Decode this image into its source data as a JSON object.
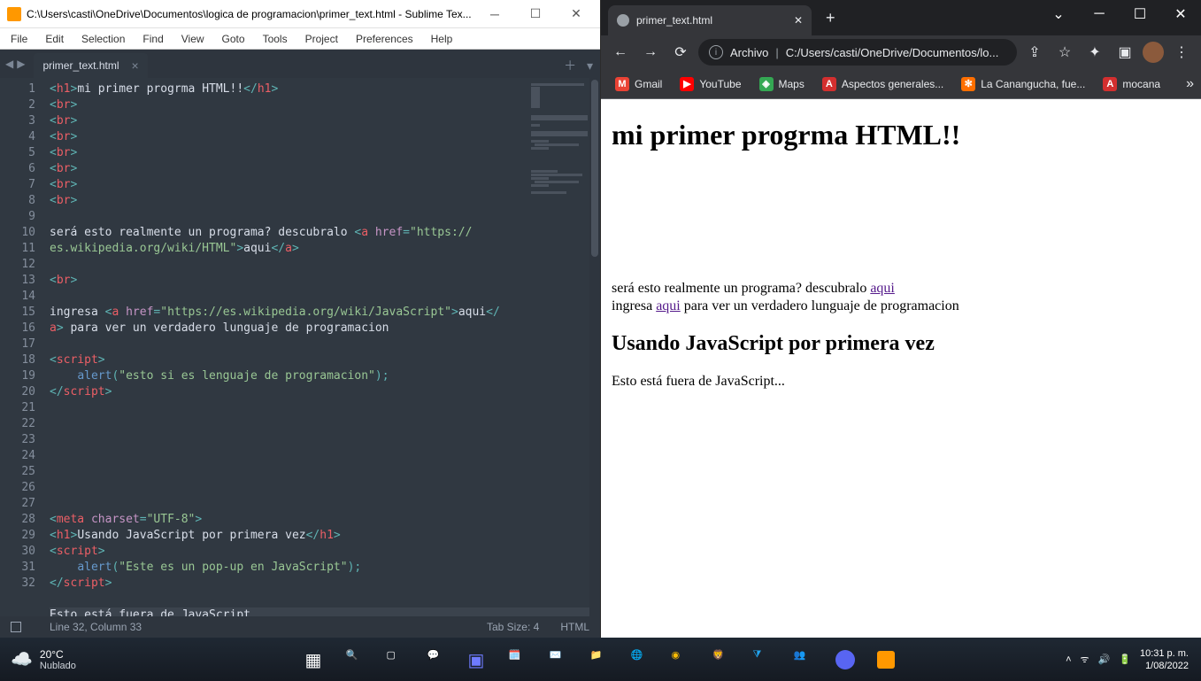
{
  "sublime": {
    "title": "C:\\Users\\casti\\OneDrive\\Documentos\\logica de programacion\\primer_text.html - Sublime Tex...",
    "menu": [
      "File",
      "Edit",
      "Selection",
      "Find",
      "View",
      "Goto",
      "Tools",
      "Project",
      "Preferences",
      "Help"
    ],
    "tab_name": "primer_text.html",
    "status_lines": "Line 32, Column 33",
    "status_tab": "Tab Size: 4",
    "status_lang": "HTML",
    "code": [
      {
        "n": 1,
        "seg": [
          [
            "punct",
            "<"
          ],
          [
            "tag",
            "h1"
          ],
          [
            "punct",
            ">"
          ],
          [
            "txt",
            "mi primer progrma HTML!!"
          ],
          [
            "punct",
            "</"
          ],
          [
            "tag",
            "h1"
          ],
          [
            "punct",
            ">"
          ]
        ]
      },
      {
        "n": 2,
        "seg": [
          [
            "punct",
            "<"
          ],
          [
            "tag",
            "br"
          ],
          [
            "punct",
            ">"
          ]
        ]
      },
      {
        "n": 3,
        "seg": [
          [
            "punct",
            "<"
          ],
          [
            "tag",
            "br"
          ],
          [
            "punct",
            ">"
          ]
        ]
      },
      {
        "n": 4,
        "seg": [
          [
            "punct",
            "<"
          ],
          [
            "tag",
            "br"
          ],
          [
            "punct",
            ">"
          ]
        ]
      },
      {
        "n": 5,
        "seg": [
          [
            "punct",
            "<"
          ],
          [
            "tag",
            "br"
          ],
          [
            "punct",
            ">"
          ]
        ]
      },
      {
        "n": 6,
        "seg": [
          [
            "punct",
            "<"
          ],
          [
            "tag",
            "br"
          ],
          [
            "punct",
            ">"
          ]
        ]
      },
      {
        "n": 7,
        "seg": [
          [
            "punct",
            "<"
          ],
          [
            "tag",
            "br"
          ],
          [
            "punct",
            ">"
          ]
        ]
      },
      {
        "n": 8,
        "seg": [
          [
            "punct",
            "<"
          ],
          [
            "tag",
            "br"
          ],
          [
            "punct",
            ">"
          ]
        ]
      },
      {
        "n": 9,
        "seg": []
      },
      {
        "n": 10,
        "seg": [
          [
            "txt",
            "será esto realmente un programa? descubralo "
          ],
          [
            "punct",
            "<"
          ],
          [
            "tag",
            "a"
          ],
          [
            "txt",
            " "
          ],
          [
            "attr",
            "href"
          ],
          [
            "punct",
            "="
          ],
          [
            "str",
            "\"https://"
          ]
        ]
      },
      {
        "n": "",
        "seg": [
          [
            "str",
            "es.wikipedia.org/wiki/HTML\""
          ],
          [
            "punct",
            ">"
          ],
          [
            "txt",
            "aqui"
          ],
          [
            "punct",
            "</"
          ],
          [
            "tag",
            "a"
          ],
          [
            "punct",
            ">"
          ]
        ]
      },
      {
        "n": 11,
        "seg": []
      },
      {
        "n": 12,
        "seg": [
          [
            "punct",
            "<"
          ],
          [
            "tag",
            "br"
          ],
          [
            "punct",
            ">"
          ]
        ]
      },
      {
        "n": 13,
        "seg": []
      },
      {
        "n": 14,
        "seg": [
          [
            "txt",
            "ingresa "
          ],
          [
            "punct",
            "<"
          ],
          [
            "tag",
            "a"
          ],
          [
            "txt",
            " "
          ],
          [
            "attr",
            "href"
          ],
          [
            "punct",
            "="
          ],
          [
            "str",
            "\"https://es.wikipedia.org/wiki/JavaScript\""
          ],
          [
            "punct",
            ">"
          ],
          [
            "txt",
            "aqui"
          ],
          [
            "punct",
            "</"
          ]
        ]
      },
      {
        "n": "",
        "seg": [
          [
            "tag",
            "a"
          ],
          [
            "punct",
            ">"
          ],
          [
            "txt",
            " para ver un verdadero lunguaje de programacion"
          ]
        ]
      },
      {
        "n": 15,
        "seg": []
      },
      {
        "n": 16,
        "seg": [
          [
            "punct",
            "<"
          ],
          [
            "tag",
            "script"
          ],
          [
            "punct",
            ">"
          ]
        ]
      },
      {
        "n": 17,
        "seg": [
          [
            "txt",
            "    "
          ],
          [
            "fn",
            "alert"
          ],
          [
            "punct",
            "("
          ],
          [
            "str",
            "\"esto si es lenguaje de programacion\""
          ],
          [
            "punct",
            ");"
          ]
        ]
      },
      {
        "n": 18,
        "seg": [
          [
            "punct",
            "</"
          ],
          [
            "tag",
            "script"
          ],
          [
            "punct",
            ">"
          ]
        ]
      },
      {
        "n": 19,
        "seg": []
      },
      {
        "n": 20,
        "seg": []
      },
      {
        "n": 21,
        "seg": []
      },
      {
        "n": 22,
        "seg": []
      },
      {
        "n": 23,
        "seg": []
      },
      {
        "n": 24,
        "seg": []
      },
      {
        "n": 25,
        "seg": []
      },
      {
        "n": 26,
        "seg": [
          [
            "punct",
            "<"
          ],
          [
            "tag",
            "meta"
          ],
          [
            "txt",
            " "
          ],
          [
            "attr",
            "charset"
          ],
          [
            "punct",
            "="
          ],
          [
            "str",
            "\"UTF-8\""
          ],
          [
            "punct",
            ">"
          ]
        ]
      },
      {
        "n": 27,
        "seg": [
          [
            "punct",
            "<"
          ],
          [
            "tag",
            "h1"
          ],
          [
            "punct",
            ">"
          ],
          [
            "txt",
            "Usando JavaScript por primera vez"
          ],
          [
            "punct",
            "</"
          ],
          [
            "tag",
            "h1"
          ],
          [
            "punct",
            ">"
          ]
        ]
      },
      {
        "n": 28,
        "seg": [
          [
            "punct",
            "<"
          ],
          [
            "tag",
            "script"
          ],
          [
            "punct",
            ">"
          ]
        ]
      },
      {
        "n": 29,
        "seg": [
          [
            "txt",
            "    "
          ],
          [
            "fn",
            "alert"
          ],
          [
            "punct",
            "("
          ],
          [
            "str",
            "\"Este es un pop-up en JavaScript\""
          ],
          [
            "punct",
            ");"
          ]
        ]
      },
      {
        "n": 30,
        "seg": [
          [
            "punct",
            "</"
          ],
          [
            "tag",
            "script"
          ],
          [
            "punct",
            ">"
          ]
        ]
      },
      {
        "n": 31,
        "seg": []
      },
      {
        "n": 32,
        "hl": true,
        "seg": [
          [
            "txt",
            "Esto está fuera de JavaScript..."
          ]
        ]
      }
    ]
  },
  "chrome": {
    "tab_title": "primer_text.html",
    "omni_label": "Archivo",
    "omni_path": "C:/Users/casti/OneDrive/Documentos/lo...",
    "bookmarks": [
      {
        "ico": "M",
        "bg": "#ea4335",
        "label": "Gmail"
      },
      {
        "ico": "▶",
        "bg": "#ff0000",
        "label": "YouTube"
      },
      {
        "ico": "◈",
        "bg": "#34a853",
        "label": "Maps"
      },
      {
        "ico": "A",
        "bg": "#d32f2f",
        "label": "Aspectos generales..."
      },
      {
        "ico": "✻",
        "bg": "#ff6f00",
        "label": "La Canangucha, fue..."
      },
      {
        "ico": "A",
        "bg": "#d32f2f",
        "label": "mocana"
      }
    ],
    "page": {
      "h1": "mi primer progrma HTML!!",
      "p1_pre": "será esto realmente un programa? descubralo ",
      "p1_link": "aqui",
      "p2_pre": "ingresa ",
      "p2_link": "aqui",
      "p2_post": " para ver un verdadero lunguaje de programacion",
      "h2": "Usando JavaScript por primera vez",
      "p3": "Esto está fuera de JavaScript..."
    }
  },
  "taskbar": {
    "temp": "20°C",
    "weather": "Nublado",
    "time": "10:31 p. m.",
    "date": "1/08/2022"
  }
}
